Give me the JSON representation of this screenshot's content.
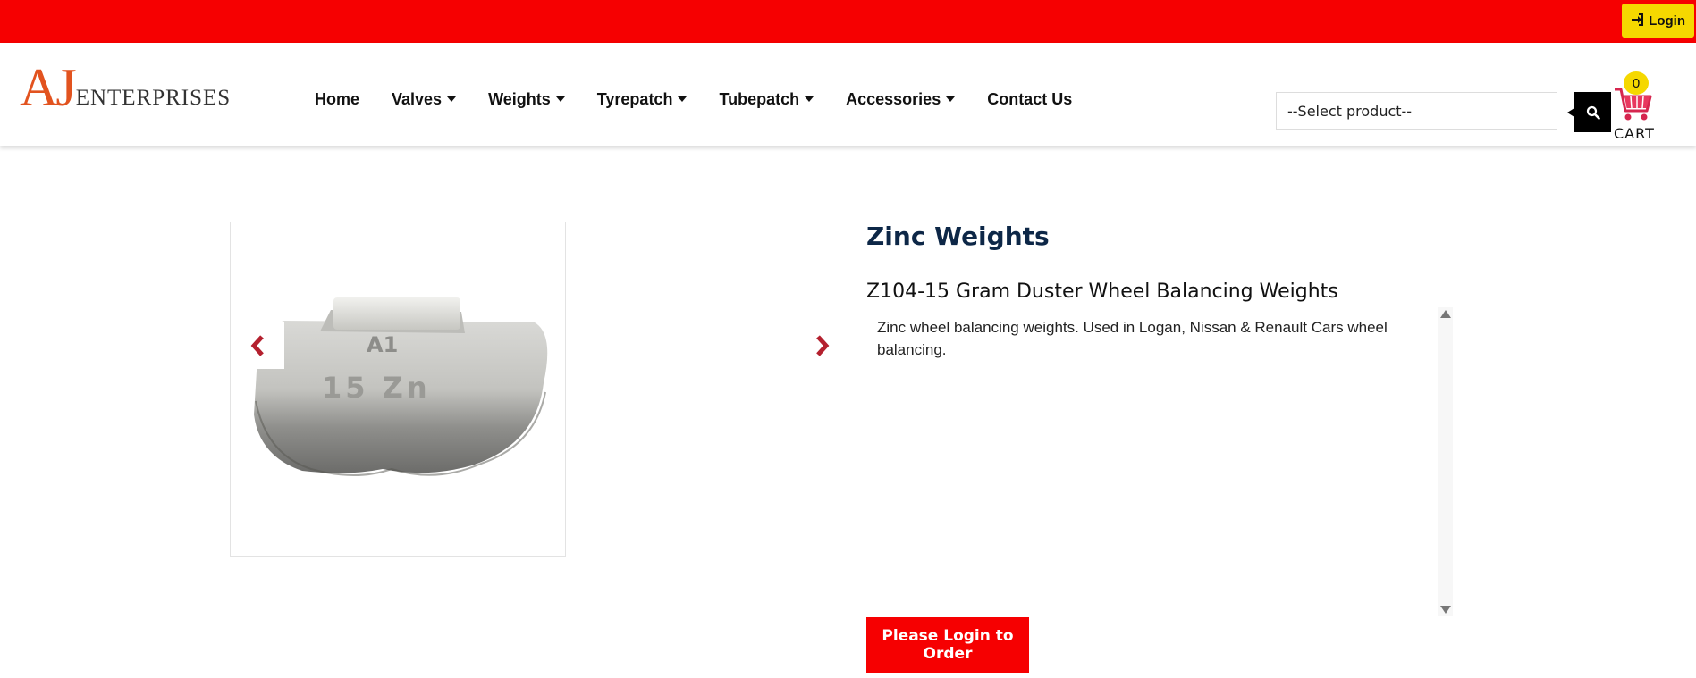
{
  "topbar": {
    "login_label": "Login",
    "login_icon": "sign-in-icon"
  },
  "logo": {
    "initials": "AJ",
    "word": "ENTERPRISES"
  },
  "nav": {
    "items": [
      {
        "label": "Home",
        "dropdown": false
      },
      {
        "label": "Valves",
        "dropdown": true
      },
      {
        "label": "Weights",
        "dropdown": true
      },
      {
        "label": "Tyrepatch",
        "dropdown": true
      },
      {
        "label": "Tubepatch",
        "dropdown": true
      },
      {
        "label": "Accessories",
        "dropdown": true
      },
      {
        "label": "Contact Us",
        "dropdown": false
      }
    ]
  },
  "search": {
    "select_value": "--Select product--",
    "icon": "search-icon"
  },
  "cart": {
    "count": "0",
    "label": "CART"
  },
  "product": {
    "category": "Zinc Weights",
    "title": "Z104-15 Gram Duster Wheel Balancing Weights",
    "description": "Zinc wheel balancing weights. Used in Logan, Nissan & Renault Cars wheel balancing.",
    "image_marks": {
      "top": "A1",
      "bottom": "15 Zn"
    },
    "order_button": "Please Login to Order"
  },
  "colors": {
    "brand_red": "#f60001",
    "accent_yellow": "#f5d800",
    "heading_navy": "#0d2747",
    "arrow_red": "#b4202e"
  }
}
